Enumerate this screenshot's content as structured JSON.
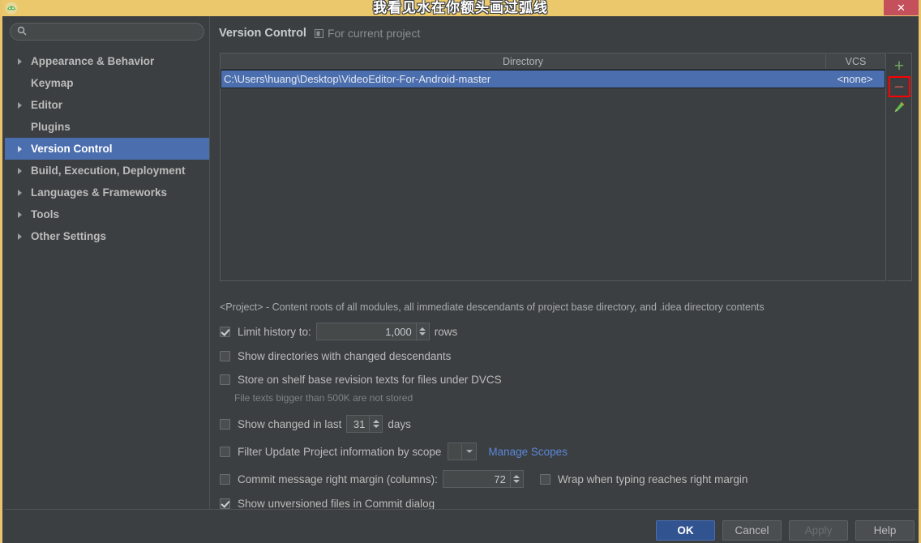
{
  "titlebar": {
    "title": "我看见水在你额头画过弧线",
    "app_icon": "android-studio-icon",
    "close_label": "✕"
  },
  "sidebar": {
    "search": {
      "value": "",
      "placeholder": ""
    },
    "items": [
      {
        "label": "Appearance & Behavior",
        "expandable": true,
        "selected": false
      },
      {
        "label": "Keymap",
        "expandable": false,
        "selected": false
      },
      {
        "label": "Editor",
        "expandable": true,
        "selected": false
      },
      {
        "label": "Plugins",
        "expandable": false,
        "selected": false
      },
      {
        "label": "Version Control",
        "expandable": true,
        "selected": true
      },
      {
        "label": "Build, Execution, Deployment",
        "expandable": true,
        "selected": false
      },
      {
        "label": "Languages & Frameworks",
        "expandable": true,
        "selected": false
      },
      {
        "label": "Tools",
        "expandable": true,
        "selected": false
      },
      {
        "label": "Other Settings",
        "expandable": true,
        "selected": false
      }
    ]
  },
  "content": {
    "title": "Version Control",
    "scope_label": "For current project",
    "table": {
      "columns": [
        "Directory",
        "VCS"
      ],
      "rows": [
        {
          "directory": "C:\\Users\\huang\\Desktop\\VideoEditor-For-Android-master",
          "vcs": "<none>",
          "selected": true
        }
      ]
    },
    "toolbar": {
      "add_label": "+",
      "remove_label": "−",
      "edit_label": "edit-pencil-icon"
    },
    "hint": "<Project> - Content roots of all modules, all immediate descendants of project base directory, and .idea directory contents",
    "options": {
      "limit_history": {
        "label": "Limit history to:",
        "checked": true,
        "value": "1,000",
        "suffix": "rows"
      },
      "show_dirs_changed": {
        "label": "Show directories with changed descendants",
        "checked": false
      },
      "store_on_shelf": {
        "label": "Store on shelf base revision texts for files under DVCS",
        "checked": false,
        "note": "File texts bigger than 500K are not stored"
      },
      "show_changed_last": {
        "label": "Show changed in last",
        "checked": false,
        "value": "31",
        "suffix": "days"
      },
      "filter_by_scope": {
        "label": "Filter Update Project information by scope",
        "checked": false,
        "selected_scope": "",
        "link": "Manage Scopes"
      },
      "commit_margin": {
        "label": "Commit message right margin (columns):",
        "checked": false,
        "value": "72",
        "wrap_label": "Wrap when typing reaches right margin",
        "wrap_checked": false
      },
      "show_unversioned": {
        "label": "Show unversioned files in Commit dialog",
        "checked": true
      }
    }
  },
  "footer": {
    "buttons": [
      {
        "label": "OK",
        "style": "primary"
      },
      {
        "label": "Cancel",
        "style": "normal"
      },
      {
        "label": "Apply",
        "style": "disabled"
      },
      {
        "label": "Help",
        "style": "normal"
      }
    ]
  },
  "colors": {
    "accent_selection": "#4b6eaf",
    "titlebar": "#ebc86c",
    "background": "#3c3f41",
    "link": "#5a86d8",
    "highlight_box": "#ff0000",
    "close_button": "#c4505c"
  }
}
